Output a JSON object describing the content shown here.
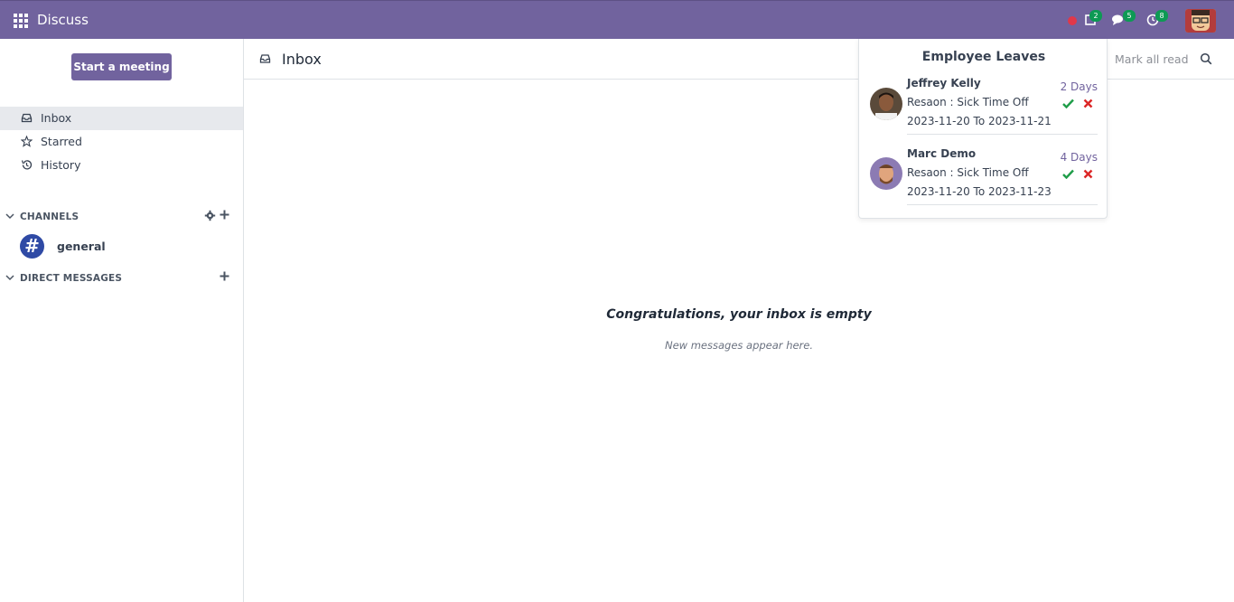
{
  "navbar": {
    "app_title": "Discuss",
    "badges": {
      "activities": "2",
      "messages": "5",
      "clock": "8"
    },
    "accent": "#71639e"
  },
  "sidebar": {
    "meeting_button": "Start a meeting",
    "items": [
      {
        "label": "Inbox",
        "icon": "inbox-icon",
        "active": true
      },
      {
        "label": "Starred",
        "icon": "star-icon",
        "active": false
      },
      {
        "label": "History",
        "icon": "history-icon",
        "active": false
      }
    ],
    "channels_header": "CHANNELS",
    "channels": [
      {
        "symbol": "#",
        "name": "general"
      }
    ],
    "dm_header": "DIRECT MESSAGES"
  },
  "main": {
    "title": "Inbox",
    "mark_all_read": "Mark all read",
    "empty_title": "Congratulations, your inbox is empty",
    "empty_subtitle": "New messages appear here."
  },
  "popup": {
    "title": "Employee Leaves",
    "leaves": [
      {
        "name": "Jeffrey Kelly",
        "reason": "Resaon : Sick Time Off",
        "dates": "2023-11-20 To 2023-11-21",
        "days": "2 Days"
      },
      {
        "name": "Marc Demo",
        "reason": "Resaon : Sick Time Off",
        "dates": "2023-11-20 To 2023-11-23",
        "days": "4 Days"
      }
    ]
  }
}
